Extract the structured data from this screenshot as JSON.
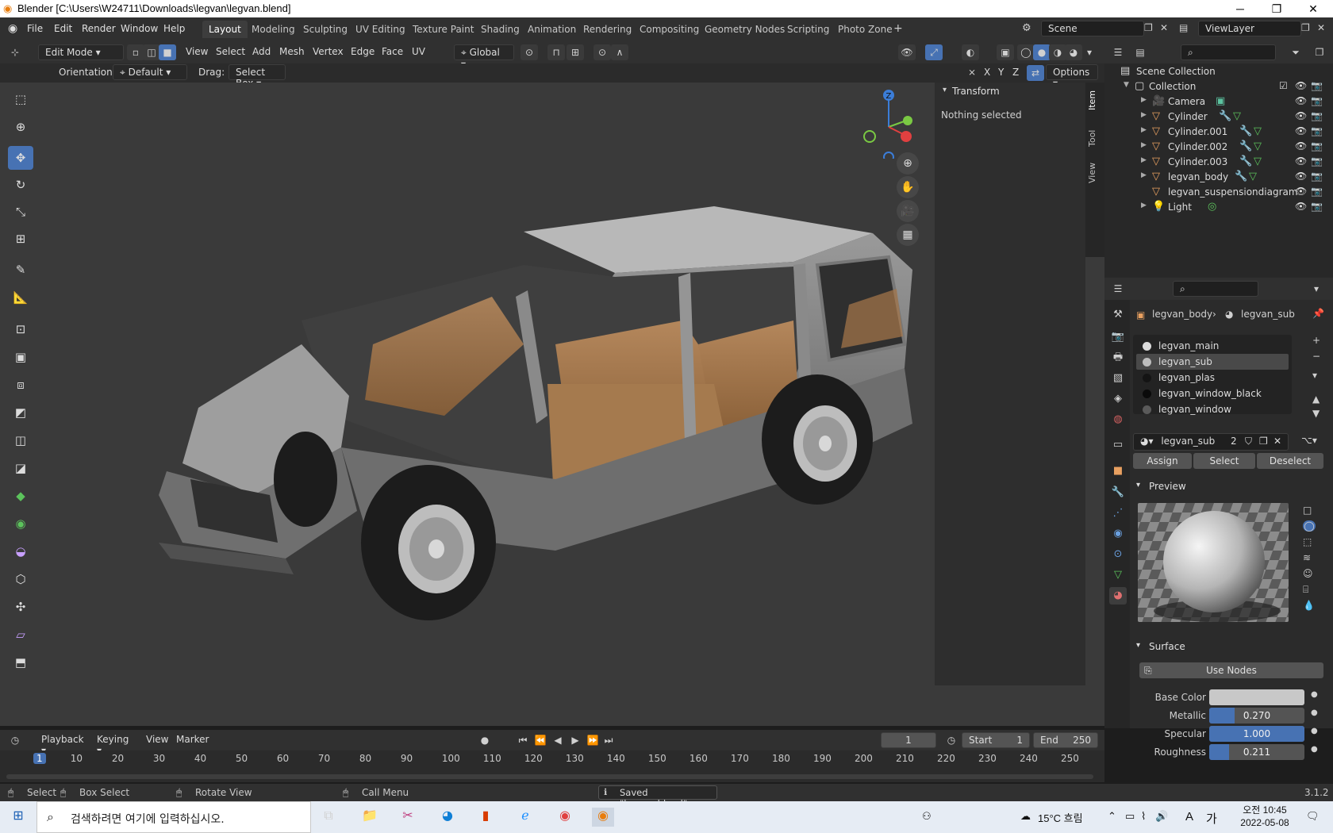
{
  "window": {
    "title": "Blender [C:\\Users\\W24711\\Downloads\\legvan\\legvan.blend]",
    "minimize": "─",
    "maximize": "❐",
    "close": "✕"
  },
  "menus": [
    "File",
    "Edit",
    "Render",
    "Window",
    "Help"
  ],
  "workspaces": [
    "Layout",
    "Modeling",
    "Sculpting",
    "UV Editing",
    "Texture Paint",
    "Shading",
    "Animation",
    "Rendering",
    "Compositing",
    "Geometry Nodes",
    "Scripting",
    "Photo Zone"
  ],
  "scene": {
    "scene_name": "Scene",
    "viewlayer_name": "ViewLayer"
  },
  "header": {
    "mode": "Edit Mode",
    "view": "View",
    "select": "Select",
    "add": "Add",
    "mesh": "Mesh",
    "vertex": "Vertex",
    "edge": "Edge",
    "face": "Face",
    "uv": "UV",
    "transform_orientation": "Global",
    "options": "Options",
    "x": "X",
    "y": "Y",
    "z": "Z"
  },
  "tool_settings": {
    "orientation_label": "Orientation:",
    "orientation_value": "Default",
    "drag_label": "Drag:",
    "drag_value": "Select Box"
  },
  "npanel": {
    "section": "Transform",
    "message": "Nothing selected",
    "tabs": [
      "Item",
      "Tool",
      "View"
    ]
  },
  "outliner": {
    "root": "Scene Collection",
    "collection": "Collection",
    "objects": [
      {
        "name": "Camera",
        "type": "camera"
      },
      {
        "name": "Cylinder",
        "type": "mesh"
      },
      {
        "name": "Cylinder.001",
        "type": "mesh"
      },
      {
        "name": "Cylinder.002",
        "type": "mesh"
      },
      {
        "name": "Cylinder.003",
        "type": "mesh"
      },
      {
        "name": "legvan_body",
        "type": "mesh"
      },
      {
        "name": "legvan_suspensiondiagram",
        "type": "mesh"
      },
      {
        "name": "Light",
        "type": "light"
      }
    ]
  },
  "properties": {
    "breadcrumb_object": "legvan_body",
    "breadcrumb_material": "legvan_sub",
    "slots": [
      {
        "name": "legvan_main",
        "color": "#dcdcdc"
      },
      {
        "name": "legvan_sub",
        "color": "#bdbdbd"
      },
      {
        "name": "legvan_plas",
        "color": "#141414"
      },
      {
        "name": "legvan_window_black",
        "color": "#0a0a0a"
      },
      {
        "name": "legvan_window",
        "color": "#5a5a5a"
      }
    ],
    "active_material": "legvan_sub",
    "users": "2",
    "assign": "Assign",
    "select": "Select",
    "deselect": "Deselect",
    "preview_label": "Preview",
    "surface_label": "Surface",
    "use_nodes": "Use Nodes",
    "base_color_label": "Base Color",
    "metallic_label": "Metallic",
    "metallic_value": "0.270",
    "metallic_fraction": 0.27,
    "specular_label": "Specular",
    "specular_value": "1.000",
    "specular_fraction": 1.0,
    "roughness_label": "Roughness",
    "roughness_value": "0.211",
    "roughness_fraction": 0.211
  },
  "timeline": {
    "playback": "Playback",
    "keying": "Keying",
    "view": "View",
    "marker": "Marker",
    "current_frame": "1",
    "start_label": "Start",
    "start_value": "1",
    "end_label": "End",
    "end_value": "250",
    "ruler": [
      "1",
      "10",
      "20",
      "30",
      "40",
      "50",
      "60",
      "70",
      "80",
      "90",
      "100",
      "110",
      "120",
      "130",
      "140",
      "150",
      "160",
      "170",
      "180",
      "190",
      "200",
      "210",
      "220",
      "230",
      "240",
      "250"
    ]
  },
  "statusbar": {
    "select": "Select",
    "box_select": "Box Select",
    "rotate_view": "Rotate View",
    "call_menu": "Call Menu",
    "saved": "Saved \"legvan.blend\"",
    "version": "3.1.2"
  },
  "taskbar": {
    "search_placeholder": "검색하려면 여기에 입력하십시오.",
    "weather": "15°C 흐림",
    "lang": "A",
    "ime": "가",
    "time": "오전 10:45",
    "date": "2022-05-08"
  }
}
